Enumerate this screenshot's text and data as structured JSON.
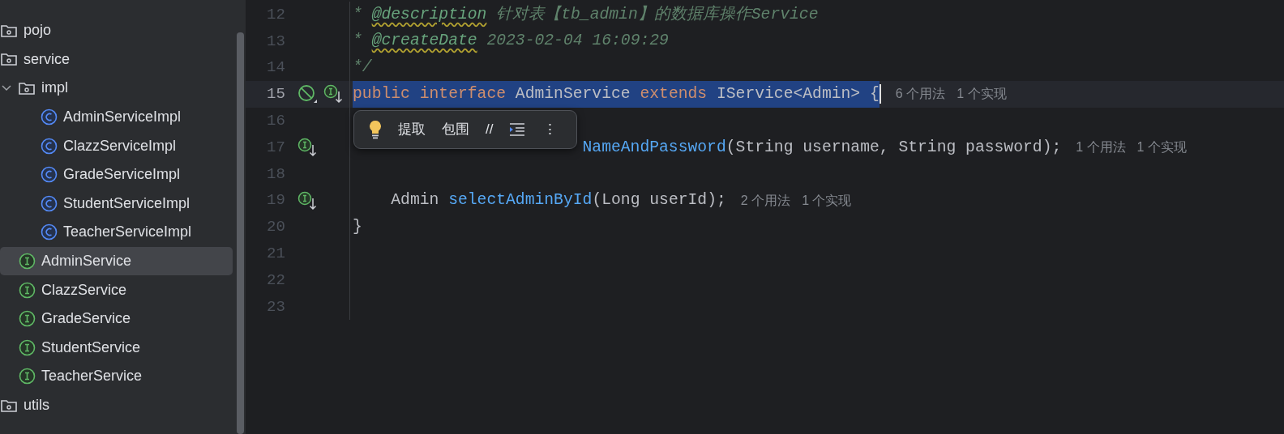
{
  "project_tree": [
    {
      "label": "pojo",
      "kind": "folder",
      "selected": false
    },
    {
      "label": "service",
      "kind": "folder",
      "selected": false,
      "children": [
        {
          "label": "impl",
          "kind": "folder",
          "expanded": true,
          "selected": false,
          "children": [
            {
              "label": "AdminServiceImpl",
              "kind": "class",
              "selected": false
            },
            {
              "label": "ClazzServiceImpl",
              "kind": "class",
              "selected": false
            },
            {
              "label": "GradeServiceImpl",
              "kind": "class",
              "selected": false
            },
            {
              "label": "StudentServiceImpl",
              "kind": "class",
              "selected": false
            },
            {
              "label": "TeacherServiceImpl",
              "kind": "class",
              "selected": false
            }
          ]
        },
        {
          "label": "AdminService",
          "kind": "interface",
          "selected": true
        },
        {
          "label": "ClazzService",
          "kind": "interface",
          "selected": false
        },
        {
          "label": "GradeService",
          "kind": "interface",
          "selected": false
        },
        {
          "label": "StudentService",
          "kind": "interface",
          "selected": false
        },
        {
          "label": "TeacherService",
          "kind": "interface",
          "selected": false
        }
      ]
    },
    {
      "label": "utils",
      "kind": "folder",
      "selected": false
    }
  ],
  "editor": {
    "lines": [
      {
        "number": "12",
        "selected": false,
        "tokens": [
          {
            "kind": "comment",
            "text": "* "
          },
          {
            "kind": "tag",
            "text": "@description"
          },
          {
            "kind": "comment",
            "text": " 针对表【tb_admin】的数据库操作Service"
          }
        ]
      },
      {
        "number": "13",
        "selected": false,
        "tokens": [
          {
            "kind": "comment",
            "text": "* "
          },
          {
            "kind": "tag",
            "text": "@createDate"
          },
          {
            "kind": "comment",
            "text": " 2023-02-04 16:09:29"
          }
        ]
      },
      {
        "number": "14",
        "selected": false,
        "tokens": [
          {
            "kind": "comment",
            "text": "*/"
          }
        ]
      },
      {
        "number": "15",
        "selected": true,
        "gutter_icons": [
          {
            "kind": "disabled"
          },
          {
            "kind": "implemented"
          }
        ],
        "tokens": [
          {
            "kind": "keyword",
            "text": "public "
          },
          {
            "kind": "keyword",
            "text": "interface "
          },
          {
            "kind": "plain",
            "text": "AdminService "
          },
          {
            "kind": "keyword",
            "text": "extends "
          },
          {
            "kind": "plain",
            "text": "IService<Admin> {"
          }
        ],
        "hints": [
          "6 个用法",
          "1 个实现"
        ]
      },
      {
        "number": "16",
        "selected": false
      },
      {
        "number": "17",
        "selected": false,
        "kind": "under-popup",
        "gutter_icons": [
          {
            "kind": "implemented"
          }
        ],
        "tokens": [
          {
            "kind": "method",
            "text": "NameAndPassword"
          },
          {
            "kind": "plain",
            "text": "(String username, String password);"
          }
        ],
        "hints": [
          "1 个用法",
          "1 个实现"
        ]
      },
      {
        "number": "18",
        "selected": false
      },
      {
        "number": "19",
        "selected": false,
        "gutter_icons": [
          {
            "kind": "implemented"
          }
        ],
        "tokens": [
          {
            "kind": "plain",
            "text": "    Admin "
          },
          {
            "kind": "method",
            "text": "selectAdminById"
          },
          {
            "kind": "plain",
            "text": "(Long userId);"
          }
        ],
        "hints": [
          "2 个用法",
          "1 个实现"
        ]
      },
      {
        "number": "20",
        "selected": false,
        "tokens": [
          {
            "kind": "plain",
            "text": "}"
          }
        ]
      },
      {
        "number": "21",
        "selected": false
      },
      {
        "number": "22",
        "selected": false
      },
      {
        "number": "23",
        "selected": false
      }
    ],
    "popup": {
      "items": [
        {
          "kind": "bulb"
        },
        {
          "kind": "text",
          "label": "提取"
        },
        {
          "kind": "text",
          "label": "包围"
        },
        {
          "kind": "text",
          "label": "//"
        },
        {
          "kind": "indent"
        },
        {
          "kind": "text",
          "label": "⋮"
        }
      ]
    }
  }
}
